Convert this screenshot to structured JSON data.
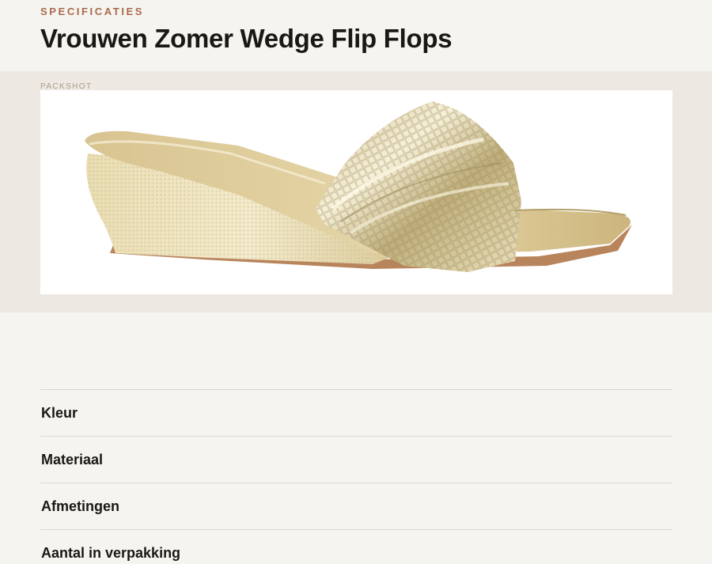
{
  "header": {
    "eyebrow": "SPECIFICATIES",
    "title": "Vrouwen Zomer Wedge Flip Flops"
  },
  "packshot": {
    "label": "PACKSHOT",
    "colors": {
      "gold_light": "#efe6c4",
      "gold_mid": "#d9c99a",
      "gold_dark": "#b59f6a",
      "sole_brown": "#b8845c"
    }
  },
  "specs": [
    {
      "label": "Kleur"
    },
    {
      "label": "Materiaal"
    },
    {
      "label": "Afmetingen"
    },
    {
      "label": "Aantal in verpakking"
    }
  ]
}
